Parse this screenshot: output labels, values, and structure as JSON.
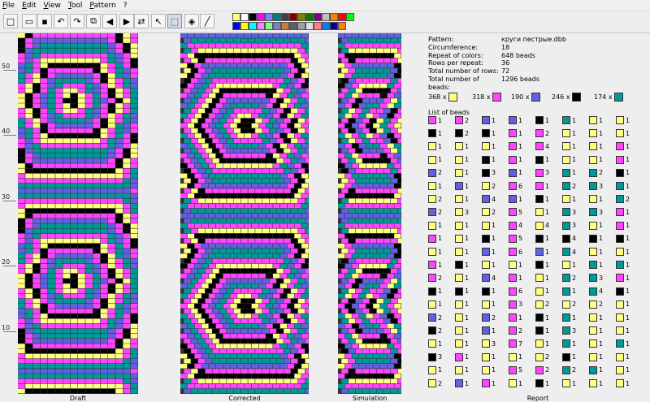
{
  "menu": [
    "File",
    "Edit",
    "View",
    "Tool",
    "Pattern",
    "?"
  ],
  "toolbar": [
    {
      "name": "new-icon",
      "glyph": "□"
    },
    {
      "name": "open-icon",
      "glyph": "▭"
    },
    {
      "name": "save-icon",
      "glyph": "▪"
    },
    {
      "name": "undo-icon",
      "glyph": "↶"
    },
    {
      "name": "redo-icon",
      "glyph": "↷"
    },
    {
      "name": "copy-icon",
      "glyph": "⧉"
    },
    {
      "name": "arrow-left-icon",
      "glyph": "◀"
    },
    {
      "name": "arrow-right-icon",
      "glyph": "▶"
    },
    {
      "name": "mirror-icon",
      "glyph": "⇄"
    },
    {
      "name": "pointer-icon",
      "glyph": "↖"
    },
    {
      "name": "select-icon",
      "glyph": "⬚"
    },
    {
      "name": "fill-icon",
      "glyph": "◈"
    },
    {
      "name": "pipette-icon",
      "glyph": "╱"
    }
  ],
  "palette": [
    "#ffff80",
    "#ffffff",
    "#000000",
    "#ff00ff",
    "#8080ff",
    "#008080",
    "#404040",
    "#800000",
    "#808000",
    "#008000",
    "#800080",
    "#c0c0c0",
    "#ff8000",
    "#ff0000",
    "#00ff00",
    "#0000ff",
    "#ffff00",
    "#00ffff",
    "#ff80ff",
    "#80ff80",
    "#8080c0",
    "#c08040",
    "#606060",
    "#a0a0a0",
    "#e0e0e0",
    "#ff8080",
    "#0080ff",
    "#000080",
    "#ff8000"
  ],
  "ruler": [
    "50",
    "40",
    "30",
    "20",
    "10"
  ],
  "panels": {
    "draft": "Draft",
    "corrected": "Corrected",
    "simulation": "Simulation",
    "report": "Report"
  },
  "info": {
    "pattern_label": "Pattern:",
    "pattern": "круги пестрые.dbb",
    "circ_label": "Circumference:",
    "circ": "18",
    "repeat_label": "Repeat of colors:",
    "repeat": "648 beads",
    "rows_rep_label": "Rows per repeat:",
    "rows_rep": "36",
    "rows_label": "Total number of rows:",
    "rows": "72",
    "beads_label": "Total number of beads:",
    "beads": "1296 beads"
  },
  "counts": [
    {
      "label": "368 x",
      "color": "#ffff80"
    },
    {
      "label": "318 x",
      "color": "#ff44ff"
    },
    {
      "label": "190 x",
      "color": "#6060e0"
    },
    {
      "label": "246 x",
      "color": "#000000"
    },
    {
      "label": "174 x",
      "color": "#009999"
    }
  ],
  "list_title": "List of beads",
  "colors": {
    "yellow": "#ffff80",
    "magenta": "#ff44ff",
    "blue": "#6060e0",
    "black": "#000000",
    "teal": "#009999"
  },
  "bead_columns": [
    [
      "magenta:1",
      "black:1",
      "yellow:1",
      "yellow:1",
      "blue:2",
      "yellow:1",
      "yellow:2",
      "blue:2",
      "yellow:1",
      "magenta:1",
      "yellow:1",
      "magenta:1",
      "magenta:2",
      "black:1",
      "yellow:1",
      "blue:2",
      "black:2",
      "yellow:1",
      "black:3",
      "yellow:1",
      "yellow:2"
    ],
    [
      "magenta:2",
      "black:2",
      "yellow:1",
      "yellow:1",
      "yellow:1",
      "blue:1",
      "yellow:1",
      "yellow:3",
      "yellow:1",
      "yellow:1",
      "yellow:1",
      "black:1",
      "yellow:1",
      "black:1",
      "yellow:1",
      "yellow:1",
      "yellow:1",
      "yellow:1",
      "magenta:1",
      "yellow:1",
      "blue:1"
    ],
    [
      "blue:1",
      "black:1",
      "yellow:1",
      "black:1",
      "black:3",
      "yellow:2",
      "blue:4",
      "yellow:2",
      "yellow:1",
      "black:1",
      "blue:1",
      "yellow:1",
      "blue:4",
      "black:1",
      "yellow:1",
      "blue:2",
      "blue:1",
      "yellow:3",
      "yellow:1",
      "yellow:1",
      "magenta:1"
    ],
    [
      "blue:1",
      "magenta:1",
      "magenta:1",
      "magenta:1",
      "blue:1",
      "magenta:6",
      "blue:1",
      "magenta:5",
      "magenta:4",
      "magenta:5",
      "magenta:6",
      "yellow:1",
      "magenta:1",
      "magenta:6",
      "magenta:3",
      "magenta:1",
      "magenta:2",
      "magenta:7",
      "yellow:1",
      "magenta:5",
      "yellow:1"
    ],
    [
      "black:1",
      "magenta:2",
      "magenta:4",
      "black:1",
      "magenta:3",
      "magenta:1",
      "black:1",
      "yellow:1",
      "yellow:4",
      "black:1",
      "blue:1",
      "black:1",
      "yellow:1",
      "yellow:1",
      "yellow:2",
      "black:1",
      "black:1",
      "yellow:1",
      "yellow:2",
      "magenta:2",
      "black:1"
    ],
    [
      "teal:1",
      "yellow:1",
      "yellow:1",
      "yellow:1",
      "teal:1",
      "teal:2",
      "yellow:1",
      "teal:3",
      "teal:3",
      "black:4",
      "teal:4",
      "yellow:1",
      "teal:2",
      "teal:1",
      "yellow:2",
      "teal:1",
      "teal:3",
      "teal:1",
      "black:1",
      "teal:2",
      "yellow:1"
    ],
    [
      "yellow:1",
      "yellow:1",
      "yellow:1",
      "yellow:1",
      "teal:2",
      "teal:3",
      "yellow:1",
      "teal:3",
      "yellow:1",
      "black:1",
      "yellow:1",
      "teal:1",
      "teal:3",
      "teal:4",
      "yellow:2",
      "yellow:1",
      "yellow:1",
      "yellow:1",
      "yellow:1",
      "teal:1",
      "yellow:1"
    ],
    [
      "yellow:1",
      "yellow:1",
      "magenta:1",
      "magenta:1",
      "black:1",
      "teal:1",
      "teal:2",
      "magenta:1",
      "magenta:1",
      "black:1",
      "yellow:1",
      "teal:1",
      "magenta:1",
      "black:1",
      "yellow:1",
      "yellow:1",
      "yellow:1",
      "teal:1",
      "yellow:1",
      "yellow:1",
      "yellow:1"
    ]
  ]
}
